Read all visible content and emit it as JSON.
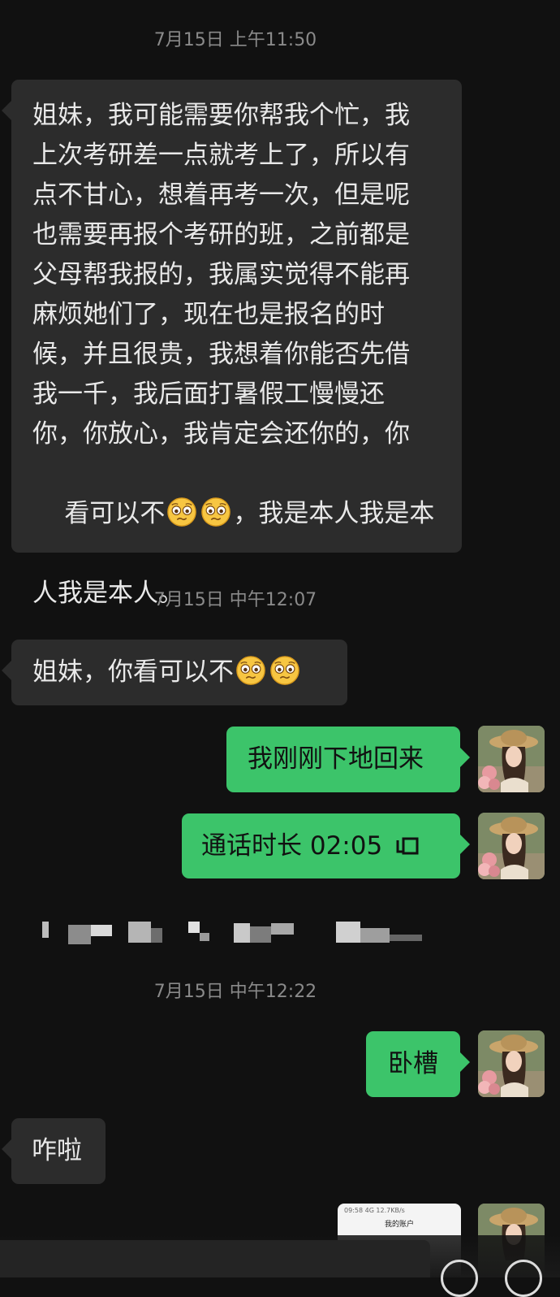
{
  "chat": {
    "timestamps": [
      "7月15日 上午11:50",
      "7月15日 中午12:07",
      "7月15日 中午12:22"
    ],
    "messages": {
      "m1": {
        "lines": [
          "姐妹，我可能需要你帮我个忙，我",
          "上次考研差一点就考上了，所以有",
          "点不甘心，想着再考一次，但是呢",
          "也需要再报个考研的班，之前都是",
          "父母帮我报的，我属实觉得不能再",
          "麻烦她们了，现在也是报名的时",
          "候，并且很贵，我想着你能否先借",
          "我一千，我后面打暑假工慢慢还",
          "你，你放心，我肯定会还你的，你"
        ],
        "line10_before": "看可以不",
        "line10_after": "，我是本人我是本",
        "line11": "人我是本人。"
      },
      "m2": {
        "text": "姐妹，你看可以不"
      },
      "m3": {
        "text": "我刚刚下地回来"
      },
      "m4": {
        "text": "通话时长 02:05"
      },
      "m5": {
        "text": "卧槽"
      },
      "m6": {
        "text": "咋啦"
      }
    },
    "preview": {
      "status": "09:58 4G 12.7KB/s",
      "title": "我的账户"
    }
  },
  "icons": {
    "emoji": "pleading-face-emoji",
    "call": "phone-call-icon",
    "avatar": "user-avatar-woman-with-hat"
  },
  "colors": {
    "background": "#111111",
    "incoming_bubble": "#2c2c2c",
    "outgoing_bubble": "#3cc46a",
    "timestamp": "#8a8a8a"
  }
}
